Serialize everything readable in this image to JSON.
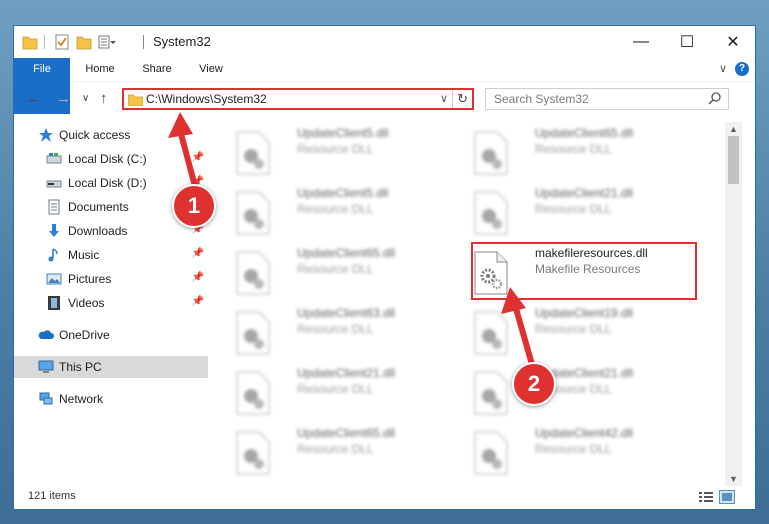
{
  "window": {
    "title": "System32",
    "controls": {
      "minimize": "—",
      "maximize": "☐",
      "close": "✕"
    }
  },
  "ribbon": {
    "tabs": [
      "File",
      "Home",
      "Share",
      "View"
    ],
    "expand": "∨",
    "help": "?"
  },
  "address": {
    "path": "C:\\Windows\\System32",
    "dropdown": "∨",
    "refresh": "↻",
    "search_placeholder": "Search System32"
  },
  "nav_buttons": {
    "back": "←",
    "forward": "→",
    "recent": "∨",
    "up": "↑"
  },
  "sidebar": {
    "items": [
      {
        "label": "Quick access",
        "icon": "star-icon"
      },
      {
        "label": "Local Disk (C:)",
        "icon": "drive-icon",
        "pinned": true
      },
      {
        "label": "Local Disk (D:)",
        "icon": "drive-icon",
        "pinned": true
      },
      {
        "label": "Documents",
        "icon": "documents-icon",
        "pinned": true
      },
      {
        "label": "Downloads",
        "icon": "downloads-icon",
        "pinned": true
      },
      {
        "label": "Music",
        "icon": "music-icon",
        "pinned": true
      },
      {
        "label": "Pictures",
        "icon": "pictures-icon",
        "pinned": true
      },
      {
        "label": "Videos",
        "icon": "videos-icon",
        "pinned": true
      },
      {
        "label": "OneDrive",
        "icon": "onedrive-icon"
      },
      {
        "label": "This PC",
        "icon": "this-pc-icon",
        "selected": true
      },
      {
        "label": "Network",
        "icon": "network-icon"
      }
    ],
    "pin_glyph": "📌"
  },
  "files": {
    "left_column": [
      {
        "name": "UpdateClient5.dll",
        "type": "Resource DLL"
      },
      {
        "name": "UpdateClient5.dll",
        "type": "Resource DLL"
      },
      {
        "name": "UpdateClient65.dll",
        "type": "Resource DLL"
      },
      {
        "name": "UpdateClient63.dll",
        "type": "Resource DLL"
      },
      {
        "name": "UpdateClient21.dll",
        "type": "Resource DLL"
      },
      {
        "name": "UpdateClient65.dll",
        "type": "Resource DLL"
      }
    ],
    "right_column": [
      {
        "name": "UpdateClient65.dll",
        "type": "Resource DLL"
      },
      {
        "name": "UpdateClient21.dll",
        "type": "Resource DLL"
      },
      {
        "name": "makefileresources.dll",
        "type": "Makefile Resources",
        "highlighted": true
      },
      {
        "name": "UpdateClient19.dll",
        "type": "Resource DLL"
      },
      {
        "name": "UpdateClient21.dll",
        "type": "Resource DLL"
      },
      {
        "name": "UpdateClient42.dll",
        "type": "Resource DLL"
      }
    ]
  },
  "status": {
    "item_count": "121 items"
  },
  "annotations": {
    "callout_1": "1",
    "callout_2": "2"
  },
  "colors": {
    "accent": "#1a6ec8",
    "annotation": "#e03131",
    "selection": "#d9d9d9"
  }
}
